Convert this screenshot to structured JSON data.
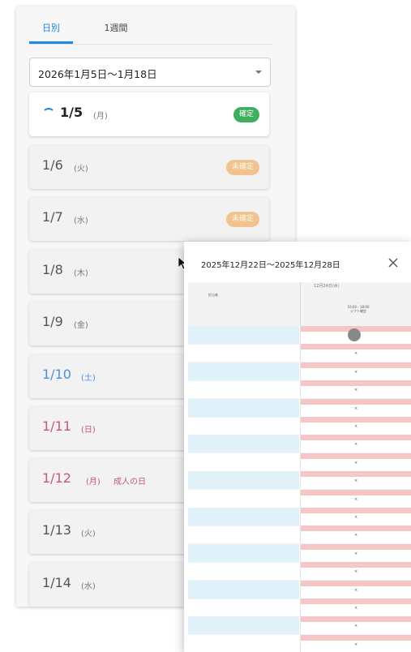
{
  "tabs": [
    "日別",
    "1週間"
  ],
  "date_range": "2026年1月5日〜1月18日",
  "days": [
    {
      "date": "1/5",
      "weekday": "(月)",
      "badge": "確定"
    },
    {
      "date": "1/6",
      "weekday": "(火)",
      "badge": "未確定"
    },
    {
      "date": "1/7",
      "weekday": "(水)",
      "badge": "未確定"
    },
    {
      "date": "1/8",
      "weekday": "(木)"
    },
    {
      "date": "1/9",
      "weekday": "(金)"
    },
    {
      "date": "1/10",
      "weekday": "(土)"
    },
    {
      "date": "1/11",
      "weekday": "(日)"
    },
    {
      "date": "1/12",
      "weekday": "(月)",
      "holiday": "成人の日"
    },
    {
      "date": "1/13",
      "weekday": "(火)"
    },
    {
      "date": "1/14",
      "weekday": "(水)"
    }
  ],
  "dialog": {
    "title": "2025年12月22日〜2025年12月28日",
    "close_icon": "close-icon",
    "column_header": "12月24日(水)",
    "left_header": "担当者",
    "cell_lines": [
      "-",
      "10:00 - 18:00",
      "シフト確定"
    ],
    "row_marker": "×"
  },
  "colors": {
    "accent": "#1e88e5",
    "confirmed": "#3fae5f",
    "unconfirmed": "#f1c48e",
    "saturday": "#4a90d9",
    "holiday": "#c2577f"
  }
}
